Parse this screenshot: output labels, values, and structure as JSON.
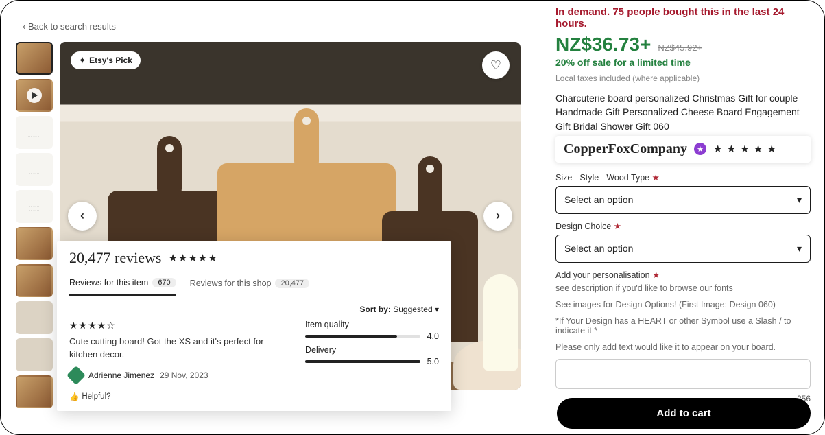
{
  "back_label": "Back to search results",
  "etsy_pick": "Etsy's Pick",
  "reviews": {
    "count_text": "20,477 reviews",
    "stars_text": "★★★★★",
    "tab_item_label": "Reviews for this item",
    "tab_item_count": "670",
    "tab_shop_label": "Reviews for this shop",
    "tab_shop_count": "20,477",
    "sort_prefix": "Sort by:",
    "sort_value": "Suggested",
    "review_stars": "★★★★☆",
    "review_text": "Cute cutting board! Got the XS and it's perfect for kitchen decor.",
    "reviewer_name": "Adrienne Jimenez",
    "review_date": "29 Nov, 2023",
    "rating_quality_label": "Item quality",
    "rating_quality_value": "4.0",
    "rating_delivery_label": "Delivery",
    "rating_delivery_value": "5.0",
    "helpful_label": "Helpful?"
  },
  "product": {
    "demand": "In demand. 75 people bought this in the last 24 hours.",
    "price": "NZ$36.73+",
    "price_old": "NZ$45.92+",
    "sale": "20% off sale for a limited time",
    "taxes": "Local taxes included (where applicable)",
    "title": "Charcuterie board personalized Christmas Gift for couple Handmade Gift Personalized Cheese Board Engagement Gift Bridal Shower Gift 060",
    "shop_name": "CopperFoxCompany",
    "shop_stars": "★ ★ ★ ★ ★",
    "option1_label": "Size - Style - Wood Type",
    "option2_label": "Design Choice",
    "select_placeholder": "Select an option",
    "personalisation_label": "Add your personalisation",
    "personalisation_hint1": "see description if you'd like to browse our fonts",
    "personalisation_hint2": "See images for Design Options! (First Image: Design 060)",
    "personalisation_hint3": "*If Your Design has a HEART or other Symbol use a Slash / to indicate it *",
    "personalisation_hint4": "Please only add text would like it to appear on your board.",
    "charcount": "256",
    "add_to_cart": "Add to cart"
  }
}
